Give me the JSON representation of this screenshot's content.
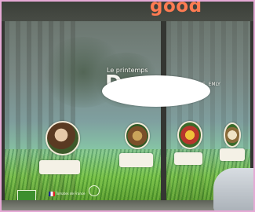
{
  "storefront": {
    "sign_left_text": "",
    "sign_brand": "good",
    "sign_subtext": "",
    "window_line_1": "Le printemps",
    "window_letter_large": "D",
    "window_line_tail": "E, EMLY",
    "logos": {
      "bio_label": "",
      "flag_caption": "Tomates de France"
    }
  },
  "colors": {
    "sign_orange": "#ff7b52",
    "grass_green": "#76c24d",
    "frame_dark": "#343632",
    "border_pink": "#e6a9d6",
    "redaction": "#ffffff"
  }
}
